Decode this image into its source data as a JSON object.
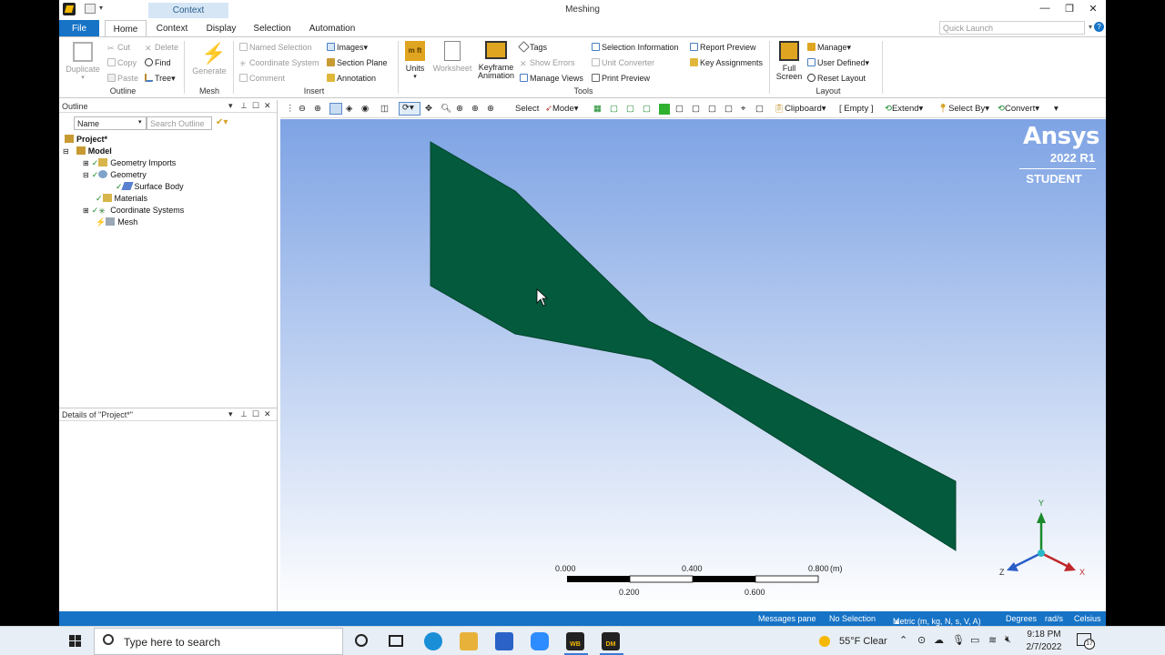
{
  "window": {
    "title": "Meshing",
    "context_tab": "Context",
    "minimize": "—",
    "restore": "❐",
    "close": "✕"
  },
  "tabs": [
    "File",
    "Home",
    "Context",
    "Display",
    "Selection",
    "Automation"
  ],
  "quick_launch_placeholder": "Quick Launch",
  "ribbon": {
    "outline": {
      "label": "Outline",
      "duplicate": "Duplicate",
      "cut": "Cut",
      "copy": "Copy",
      "paste": "Paste",
      "delete": "Delete",
      "find": "Find",
      "tree": "Tree"
    },
    "mesh": {
      "label": "Mesh",
      "generate": "Generate"
    },
    "insert": {
      "label": "Insert",
      "named_selection": "Named Selection",
      "coordinate_system": "Coordinate System",
      "comment": "Comment",
      "images": "Images",
      "section_plane": "Section Plane",
      "annotation": "Annotation"
    },
    "tools": {
      "label": "Tools",
      "units": "Units",
      "worksheet": "Worksheet",
      "keyframe_1": "Keyframe",
      "keyframe_2": "Animation",
      "tags": "Tags",
      "show_errors": "Show Errors",
      "manage_views": "Manage Views",
      "selection_information": "Selection Information",
      "unit_converter": "Unit Converter",
      "print_preview": "Print Preview",
      "report_preview": "Report Preview",
      "key_assignments": "Key Assignments"
    },
    "layout": {
      "label": "Layout",
      "full_1": "Full",
      "full_2": "Screen",
      "manage": "Manage",
      "user_defined": "User Defined",
      "reset_layout": "Reset Layout"
    }
  },
  "outline_panel": {
    "title": "Outline",
    "name_filter": "Name",
    "search_placeholder": "Search Outline",
    "tree": [
      "Project*",
      "Model",
      "Geometry Imports",
      "Geometry",
      "Surface Body",
      "Materials",
      "Coordinate Systems",
      "Mesh"
    ]
  },
  "details_panel": {
    "title": "Details of \"Project*\""
  },
  "viewport_toolbar": {
    "select": "Select",
    "mode": "Mode",
    "clipboard": "Clipboard",
    "empty": "[ Empty ]",
    "extend": "Extend",
    "select_by": "Select By",
    "convert": "Convert"
  },
  "brand": {
    "name": "Ansys",
    "version": "2022 R1",
    "edition": "STUDENT"
  },
  "scale_bar": {
    "top_labels": [
      "0.000",
      "0.400",
      "0.800"
    ],
    "bottom_labels": [
      "0.200",
      "0.600"
    ],
    "unit": "(m)"
  },
  "triad": {
    "x": "X",
    "y": "Y",
    "z": "Z"
  },
  "status_bar": {
    "messages": "Messages pane",
    "selection": "No Selection",
    "units": "Metric (m, kg, N, s, V, A)",
    "angle": "Degrees",
    "rotation": "rad/s",
    "temperature": "Celsius"
  },
  "taskbar": {
    "search_placeholder": "Type here to search",
    "weather": "55°F  Clear",
    "time": "9:18 PM",
    "date": "2/7/2022",
    "notifications": "17",
    "wb_label": "WB",
    "dm_label": "DM"
  },
  "colors": {
    "accent": "#1673c6",
    "body": "#045a3c",
    "viewport_top": "#7ea3e4",
    "viewport_bottom": "#ffffff"
  }
}
